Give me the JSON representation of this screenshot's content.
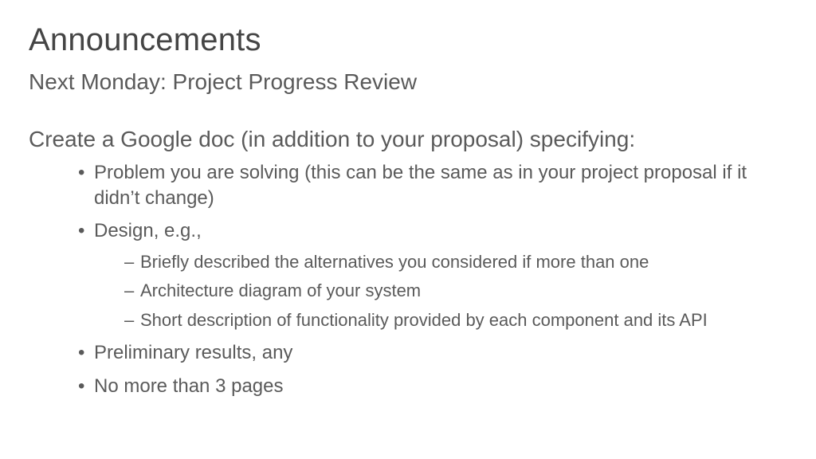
{
  "title": "Announcements",
  "subtitle": "Next Monday: Project Progress Review",
  "lead": "Create a Google doc (in addition to your proposal) specifying:",
  "bullets": [
    {
      "text": "Problem you are solving (this can be the same as in your project proposal if it didn’t change)"
    },
    {
      "text": "Design, e.g.,",
      "sub": [
        "Briefly described the alternatives you considered if more than one",
        "Architecture diagram of your system",
        "Short description of functionality provided by each component and its API"
      ]
    },
    {
      "text": "Preliminary results, any"
    },
    {
      "text": "No more than 3 pages"
    }
  ]
}
